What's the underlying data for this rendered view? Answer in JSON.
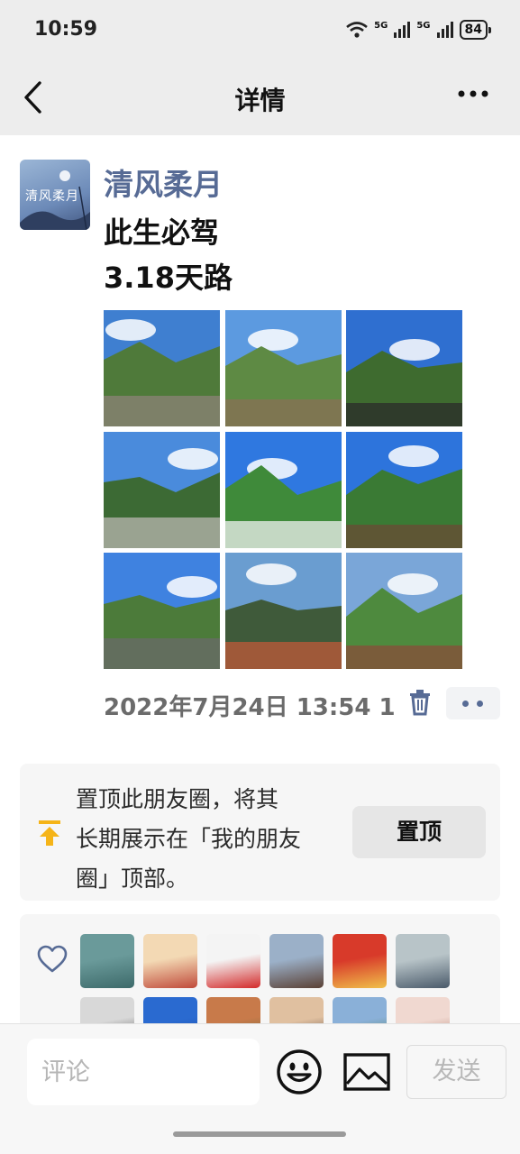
{
  "status_bar": {
    "time": "10:59",
    "network_1": "5G",
    "network_2": "5G",
    "battery": "84"
  },
  "navbar": {
    "back_icon": "chevron-left-icon",
    "title": "详情",
    "more_icon": "more-dots-icon"
  },
  "post": {
    "avatar_text": "清风柔月",
    "author": "清风柔月",
    "text_line1": "此生必驾",
    "text_line2": "3.18天路",
    "photos": [
      {
        "name": "photo-mountain-rocks",
        "sky": "#3f7fd0",
        "ground": "#4f7a3a",
        "accent": "#8c8378"
      },
      {
        "name": "photo-valley-village",
        "sky": "#5c9ae0",
        "ground": "#5e8a44",
        "accent": "#8a6f55"
      },
      {
        "name": "photo-road-traffic",
        "sky": "#2f6fd0",
        "ground": "#3e6b2f",
        "accent": "#2b2b2b"
      },
      {
        "name": "photo-river-valley",
        "sky": "#4a8bdc",
        "ground": "#3c6a34",
        "accent": "#b9b7b0"
      },
      {
        "name": "photo-prayer-flags",
        "sky": "#2f78e0",
        "ground": "#3f8a3a",
        "accent": "#f2f2f2"
      },
      {
        "name": "photo-wooden-pavilion",
        "sky": "#2d74dc",
        "ground": "#3a7a34",
        "accent": "#6b4b34"
      },
      {
        "name": "photo-cloudy-road",
        "sky": "#3f82e0",
        "ground": "#4c7b3a",
        "accent": "#6a6a6a"
      },
      {
        "name": "photo-monument-person",
        "sky": "#6a9dd0",
        "ground": "#3f5a3a",
        "accent": "#c05a3a"
      },
      {
        "name": "photo-green-hills",
        "sky": "#7aa6d8",
        "ground": "#4e8a3e",
        "accent": "#8a4c3a"
      }
    ],
    "timestamp": "2022年7月24日 13:54 1",
    "delete_icon": "trash-icon",
    "more_icon": "more-dots-icon"
  },
  "pin_card": {
    "icon": "pin-top-icon",
    "line1": "置顶此朋友圈，将其",
    "line2": "长期展示在「我的朋友",
    "line3": "圈」顶部。",
    "button_label": "置顶"
  },
  "likes": {
    "icon": "heart-icon",
    "avatars": [
      {
        "name": "liker-avatar-lake",
        "c1": "#6a9a9a",
        "c2": "#3d6a6a"
      },
      {
        "name": "liker-avatar-cartoon-girl",
        "c1": "#f3d9b4",
        "c2": "#c04a3a"
      },
      {
        "name": "liker-avatar-cherries",
        "c1": "#f4f4f4",
        "c2": "#d32a2a"
      },
      {
        "name": "liker-avatar-woman-lake",
        "c1": "#9bb0c8",
        "c2": "#5a4034"
      },
      {
        "name": "liker-avatar-horse-art",
        "c1": "#d83a2a",
        "c2": "#f0c04a"
      },
      {
        "name": "liker-avatar-man-outdoor",
        "c1": "#b8c4c8",
        "c2": "#4a5a6a"
      },
      {
        "name": "liker-avatar-person-dark",
        "c1": "#d8d8d8",
        "c2": "#333333"
      },
      {
        "name": "liker-avatar-blue-sky",
        "c1": "#2a6ad0",
        "c2": "#1a4aa0"
      },
      {
        "name": "liker-avatar-autumn",
        "c1": "#c87a4a",
        "c2": "#5a6a3a"
      },
      {
        "name": "liker-avatar-women",
        "c1": "#e0c0a0",
        "c2": "#3a2a2a"
      },
      {
        "name": "liker-avatar-landscape",
        "c1": "#8ab0d8",
        "c2": "#4a7a4a"
      },
      {
        "name": "liker-avatar-girl-pink",
        "c1": "#f0d8d0",
        "c2": "#a06a5a"
      }
    ]
  },
  "input_bar": {
    "placeholder": "评论",
    "emoji_icon": "emoji-smile-icon",
    "image_icon": "image-icon",
    "send_label": "发送"
  }
}
